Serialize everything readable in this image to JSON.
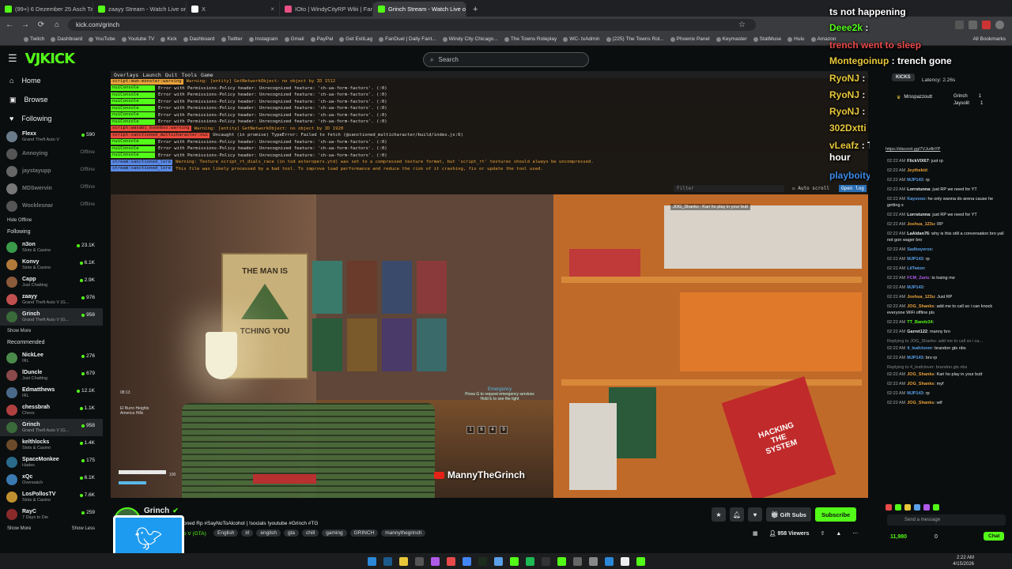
{
  "browser": {
    "tabs": [
      {
        "title": "(99+) 6 Dezember 25 Asch Tam",
        "color": "#53fc18",
        "active": false
      },
      {
        "title": "zaayy Stream - Watch Live on Kick",
        "color": "#53fc18",
        "active": false
      },
      {
        "title": "X",
        "color": "#ffffff",
        "active": false
      },
      {
        "title": "IOto | WindyCityRP Wiki | Fandom",
        "color": "#e84f82",
        "active": false
      },
      {
        "title": "Grinch Stream - Watch Live on Kick",
        "color": "#53fc18",
        "active": true
      }
    ],
    "url": "kick.com/grinch",
    "bookmarks": [
      "Twitch",
      "Dashboard",
      "YouTube",
      "Youtube TV",
      "Kick",
      "Dashboard",
      "Twitter",
      "Instagram",
      "Gmail",
      "PayPal",
      "Get ExitLag",
      "FanDuel | Daily Fant...",
      "Windy City Chicago...",
      "The Towns Roleplay",
      "WC- txAdmin",
      "(225) The Towns Rol...",
      "Phoenix Panel",
      "Keymaster",
      "StatMuse",
      "Hulu",
      "Amazon"
    ],
    "all_bookmarks": "All Bookmarks"
  },
  "kick": {
    "search_placeholder": "Search",
    "nav": [
      {
        "label": "Home",
        "icon": "home-icon"
      },
      {
        "label": "Browse",
        "icon": "browse-icon"
      },
      {
        "label": "Following",
        "icon": "heart-icon"
      }
    ],
    "top_channels": [
      {
        "name": "Flexx",
        "category": "Grand Theft Auto V",
        "viewers": "590",
        "live": true,
        "color": "#6a7b8c"
      },
      {
        "name": "Annoying",
        "category": "",
        "viewers": "Offline",
        "live": false,
        "color": "#555"
      },
      {
        "name": "jaystayupp",
        "category": "",
        "viewers": "Offline",
        "live": false,
        "color": "#666"
      },
      {
        "name": "MDSwervin",
        "category": "",
        "viewers": "Offline",
        "live": false,
        "color": "#777"
      },
      {
        "name": "Wocklesnar",
        "category": "",
        "viewers": "Offline",
        "live": false,
        "color": "#555"
      }
    ],
    "hide_offline": "Hide Offline",
    "following_header": "Following",
    "following": [
      {
        "name": "n3on",
        "category": "Slots & Casino",
        "viewers": "23.1K",
        "color": "#3a9a4a"
      },
      {
        "name": "Konvy",
        "category": "Slots & Casino",
        "viewers": "6.1K",
        "color": "#b07a3a"
      },
      {
        "name": "Capp",
        "category": "Just Chatting",
        "viewers": "2.9K",
        "color": "#8a5a3a"
      },
      {
        "name": "zaayy",
        "category": "Grand Theft Auto V (G...",
        "viewers": "976",
        "color": "#c05050"
      },
      {
        "name": "Grinch",
        "category": "Grand Theft Auto V (G...",
        "viewers": "958",
        "color": "#3a6a3a",
        "selected": true
      }
    ],
    "show_more": "Show More",
    "recommended_header": "Recommended",
    "recommended": [
      {
        "name": "NickLee",
        "category": "IRL",
        "viewers": "276",
        "color": "#4a8a4a"
      },
      {
        "name": "lDuncle",
        "category": "Just Chatting",
        "viewers": "679",
        "color": "#8a4a4a"
      },
      {
        "name": "Edmatthews",
        "category": "IRL",
        "viewers": "12.1K",
        "color": "#4a6a8a"
      },
      {
        "name": "chessbrah",
        "category": "Chess",
        "viewers": "1.1K",
        "color": "#b04040"
      },
      {
        "name": "Grinch",
        "category": "Grand Theft Auto V (G...",
        "viewers": "958",
        "color": "#3a6a3a",
        "selected": true
      },
      {
        "name": "kelthlocks",
        "category": "Slots & Casino",
        "viewers": "1.4K",
        "color": "#6a4a2a"
      },
      {
        "name": "SpaceMonkee",
        "category": "Hades",
        "viewers": "175",
        "color": "#2a6a8a"
      },
      {
        "name": "xQc",
        "category": "Overwatch",
        "viewers": "6.1K",
        "color": "#3a7ab0"
      },
      {
        "name": "LosPollosTV",
        "category": "Slots & Casino",
        "viewers": "7.6K",
        "color": "#c09030"
      },
      {
        "name": "RayC",
        "category": "7 Days to Die",
        "viewers": "259",
        "color": "#8a2a2a"
      }
    ],
    "show_more_bottom": "Show More",
    "show_less": "Show Less"
  },
  "console": {
    "menu": [
      "Overlays",
      "Launch",
      "Quit",
      "Tools",
      "Game"
    ],
    "lines": [
      {
        "tag": "script:mum-monster:warning",
        "tagcolor": "#e8a23a",
        "text": "Warning: [entity] GetNetworkObject: no object by ID 1512",
        "color": "#e8a23a"
      },
      {
        "tag": "nuiConsole",
        "tagcolor": "#53fc18",
        "text": "Error with Permissions-Policy header: Unrecognized feature: 'ch-ua-form-factors'. (:0)",
        "color": "#dcdcdc"
      },
      {
        "tag": "nuiConsole",
        "tagcolor": "#53fc18",
        "text": "Error with Permissions-Policy header: Unrecognized feature: 'ch-ua-form-factors'. (:0)",
        "color": "#dcdcdc"
      },
      {
        "tag": "nuiConsole",
        "tagcolor": "#53fc18",
        "text": "Error with Permissions-Policy header: Unrecognized feature: 'ch-ua-form-factors'. (:0)",
        "color": "#dcdcdc"
      },
      {
        "tag": "nuiConsole",
        "tagcolor": "#53fc18",
        "text": "Error with Permissions-Policy header: Unrecognized feature: 'ch-ua-form-factors'. (:0)",
        "color": "#dcdcdc"
      },
      {
        "tag": "nuiConsole",
        "tagcolor": "#53fc18",
        "text": "Error with Permissions-Policy header: Unrecognized feature: 'ch-ua-form-factors'. (:0)",
        "color": "#dcdcdc"
      },
      {
        "tag": "nuiConsole",
        "tagcolor": "#53fc18",
        "text": "Error with Permissions-Policy header: Unrecognized feature: 'ch-ua-form-factors'. (:0)",
        "color": "#dcdcdc"
      },
      {
        "tag": "script:wasabi_boombox:warning",
        "tagcolor": "#e84a3a",
        "text": "Warning: [entity] GetNetworkObject: no object by ID 1920",
        "color": "#e8a23a"
      },
      {
        "tag": "script:sanctioned_multicharacter:nui",
        "tagcolor": "#e84a3a",
        "text": "Uncaught (in promise) TypeError: Failed to fetch (@sanctioned_multicharacter/build/index.js:6)",
        "color": "#dcdcdc"
      },
      {
        "tag": "nuiConsole",
        "tagcolor": "#53fc18",
        "text": "Error with Permissions-Policy header: Unrecognized feature: 'ch-ua-form-factors'. (:0)",
        "color": "#dcdcdc"
      },
      {
        "tag": "nuiConsole",
        "tagcolor": "#53fc18",
        "text": "Error with Permissions-Policy header: Unrecognized feature: 'ch-ua-form-factors'. (:0)",
        "color": "#dcdcdc"
      },
      {
        "tag": "nuiConsole",
        "tagcolor": "#53fc18",
        "text": "Error with Permissions-Policy header: Unrecognized feature: 'ch-ua-form-factors'. (:0)",
        "color": "#dcdcdc"
      },
      {
        "tag": "stream:sanctioned_lore",
        "tagcolor": "#5a8ae8",
        "text": "Warning: Texture script_rt_dials_race (in txd asteropers.ytd) was set to a compressed texture format, but 'script_rt' textures should always be uncompressed.",
        "color": "#e8a23a"
      },
      {
        "tag": "stream:sanctioned_lore",
        "tagcolor": "#5a8ae8",
        "text": "This file was likely processed by a bad tool. To improve load performance and reduce the risk of it crashing, fix or update the tool used.",
        "color": "#e8a23a"
      }
    ],
    "filter_placeholder": "Filter",
    "auto_scroll": "Auto scroll",
    "open_log": "Open log"
  },
  "game": {
    "poster_text": "THE MAN IS",
    "poster_text2": "TCHING YOU",
    "sign_text": "HACKING THE SYSTEM",
    "streamer_tag": "MannyTheGrinch",
    "top_chat": "JOG_Shanks : Kari ho play in your butt",
    "hint_title": "Emergency",
    "hint_1": "Press G to request emergency services",
    "hint_2": "Hold E to see the light",
    "keys": [
      "1",
      "6",
      "4",
      "9"
    ],
    "location": "El Burro Heights\nAmerica Hills",
    "time": "08:13",
    "hud_value": "100"
  },
  "stream_info": {
    "channel_name": "Grinch",
    "title": "oned Rp #SayNoToAlcohol | !socials !youtube #Grinch #TG",
    "category": "o V (GTA)",
    "tags": [
      "English",
      "irl",
      "english",
      "gta",
      "chill",
      "gaming",
      "GRINCH",
      "mannythegrinch"
    ],
    "gift_subs": "Gift Subs",
    "subscribe": "Subscribe",
    "viewers": "958 Viewers"
  },
  "overlay_chat": [
    {
      "user": "",
      "text": "ts not happening",
      "color": "#ffffff"
    },
    {
      "user": "Deee2k",
      "text": "",
      "color": "#53fc18"
    },
    {
      "user": "",
      "text": "trench went to sleep",
      "color": "#e84a4a"
    },
    {
      "user": "Montegoinup",
      "text": "trench gone",
      "color": "#e8c83a"
    },
    {
      "user": "RyoNJ",
      "text": "",
      "color": "#e8c83a"
    },
    {
      "user": "RyoNJ",
      "text": "",
      "color": "#e8c83a"
    },
    {
      "user": "RyoNJ",
      "text": "",
      "color": "#e8c83a"
    },
    {
      "user": "302Dxtti",
      "text": "Trench said he goin to bed",
      "color": "#e8c83a"
    },
    {
      "user": "vLeafz",
      "text": "Ts been going on fa like an hour",
      "color": "#e8c83a"
    },
    {
      "user": "playboitymir",
      "text": "trench sleep",
      "color": "#3a8ae8"
    }
  ],
  "chat": {
    "latency": "Latency: 2.26s",
    "top_gifter": {
      "user": "Mrsspazzoutt",
      "count": "5"
    },
    "leaders": [
      {
        "user": "Grinch",
        "count": "1"
      },
      {
        "user": "Jaysolit",
        "count": "1"
      }
    ],
    "pinned_link": "https://discord.gg/7VJu4bYP",
    "messages": [
      {
        "time": "02:22 AM",
        "user": "FlickVIX67",
        "color": "#e8e8e8",
        "text": "just rp"
      },
      {
        "time": "02:22 AM",
        "user": "Jeythekid",
        "color": "#e8a23a",
        "text": ""
      },
      {
        "time": "02:22 AM",
        "user": "MJP143",
        "color": "#5aa0e8",
        "text": "rp"
      },
      {
        "time": "02:22 AM",
        "user": "Lorrstunna",
        "color": "#e8e8e8",
        "text": "just RP we need for YT"
      },
      {
        "time": "02:22 AM",
        "user": "Kayvooo",
        "color": "#5aa0e8",
        "text": "he only wanna do arena cause he getting x"
      },
      {
        "time": "02:22 AM",
        "user": "Lorrstunna",
        "color": "#e8e8e8",
        "text": "just RP we need for YT"
      },
      {
        "time": "02:22 AM",
        "user": "Joshua_123u",
        "color": "#e8a23a",
        "text": "RP"
      },
      {
        "time": "02:22 AM",
        "user": "LaAidan76",
        "color": "#e8e8e8",
        "text": "why is this still a conversation bro yall not gon wager bro"
      },
      {
        "time": "02:22 AM",
        "user": "Sadboyeros",
        "color": "#5aa0e8",
        "text": ""
      },
      {
        "time": "02:22 AM",
        "user": "MJP143",
        "color": "#5aa0e8",
        "text": "rp"
      },
      {
        "time": "02:22 AM",
        "user": "LilTwion",
        "color": "#5aa0e8",
        "text": ""
      },
      {
        "time": "02:22 AM",
        "user": "FCM_Zaris",
        "color": "#b05ae8",
        "text": "ts losing me"
      },
      {
        "time": "02:22 AM",
        "user": "MJP143",
        "color": "#5aa0e8",
        "text": ""
      },
      {
        "time": "02:22 AM",
        "user": "Joshua_123u",
        "color": "#e8a23a",
        "text": "Just RP"
      },
      {
        "time": "02:22 AM",
        "user": "JOG_Shanks",
        "color": "#e8a23a",
        "text": "add me to call so i can knock everyone WiFi offline pls"
      },
      {
        "time": "02:22 AM",
        "user": "TT_Bandz34",
        "color": "#53fc18",
        "text": ""
      },
      {
        "time": "02:22 AM",
        "user": "Garret122",
        "color": "#e8e8e8",
        "text": "manny bro"
      },
      {
        "time": "02:22 AM",
        "user": "4_leafclover",
        "color": "#5aa0e8",
        "text": "brandon gts nbs",
        "reply": "Replying to JOG_Shanks: add me to call so i ca..."
      },
      {
        "time": "02:22 AM",
        "user": "MJP143",
        "color": "#5aa0e8",
        "text": "bro rp"
      },
      {
        "time": "02:22 AM",
        "user": "JOG_Shanks",
        "color": "#e8a23a",
        "text": "Kari ho play in your butt",
        "reply": "Replying to 4_leafclover: brandon gts nbs"
      },
      {
        "time": "02:22 AM",
        "user": "JOG_Shanks",
        "color": "#e8a23a",
        "text": "myf"
      },
      {
        "time": "02:22 AM",
        "user": "MJP143",
        "color": "#5aa0e8",
        "text": "rp"
      },
      {
        "time": "02:22 AM",
        "user": "JOG_Shanks",
        "color": "#e8a23a",
        "text": "wtf"
      }
    ],
    "input_placeholder": "Send a message",
    "points": "11,980",
    "zero": "0",
    "chat_button": "Chat",
    "kicks_label": "KICKS"
  },
  "taskbar": {
    "time": "2:22 AM",
    "date": "4/15/2026"
  }
}
